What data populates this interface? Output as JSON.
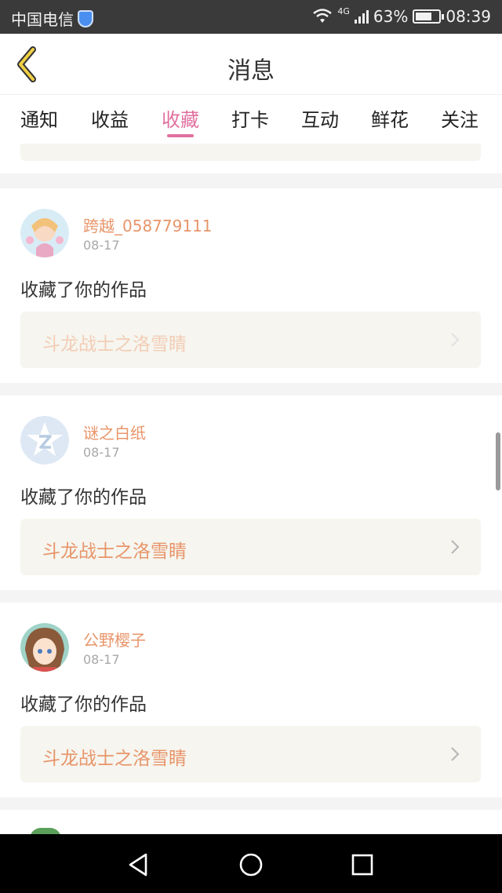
{
  "status_bar": {
    "carrier": "中国电信",
    "network": "4G",
    "battery": "63%",
    "time": "08:39"
  },
  "header": {
    "title": "消息"
  },
  "tabs": [
    {
      "label": "通知"
    },
    {
      "label": "收益"
    },
    {
      "label": "收藏",
      "active": true
    },
    {
      "label": "打卡"
    },
    {
      "label": "互动"
    },
    {
      "label": "鲜花"
    },
    {
      "label": "关注"
    }
  ],
  "items": [
    {
      "username": "跨越_058779111",
      "date": "08-17",
      "message": "收藏了你的作品",
      "work_title": "斗龙战士之洛雪睛"
    },
    {
      "username": "谜之白纸",
      "date": "08-17",
      "message": "收藏了你的作品",
      "work_title": "斗龙战士之洛雪睛"
    },
    {
      "username": "公野樱子",
      "date": "08-17",
      "message": "收藏了你的作品",
      "work_title": "斗龙战士之洛雪睛"
    }
  ],
  "colors": {
    "accent": "#e1709f",
    "name_color": "#e8956a",
    "work_box_bg": "#f6f5ef"
  }
}
